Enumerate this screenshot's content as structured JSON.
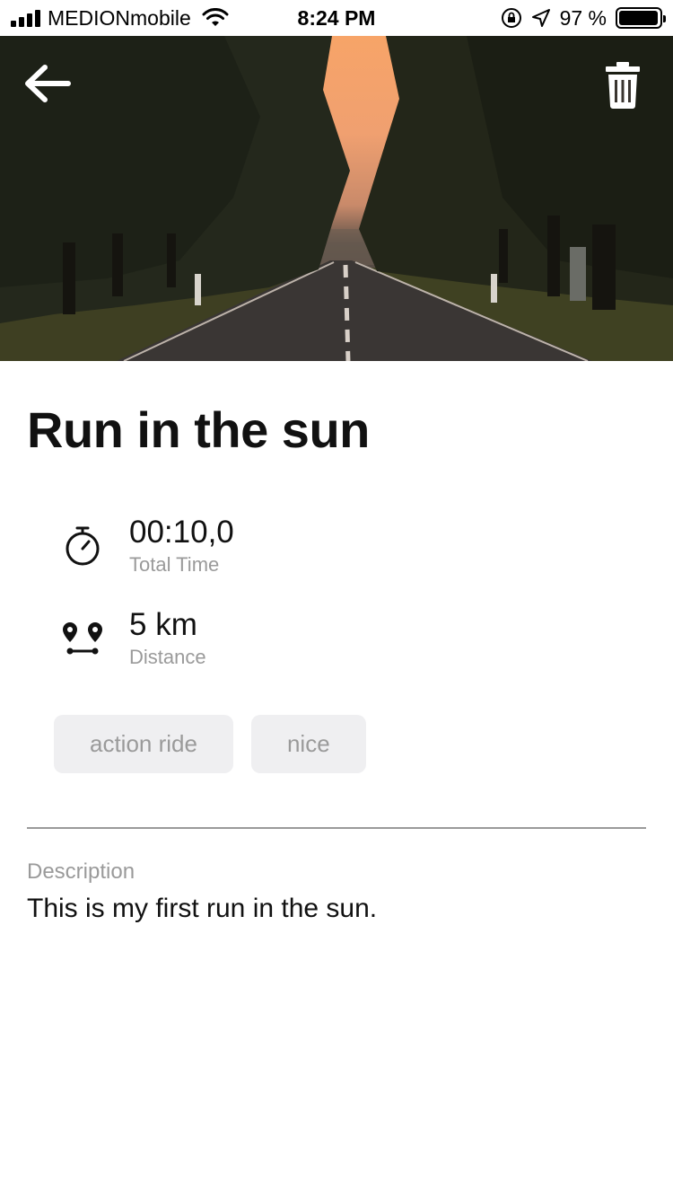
{
  "status_bar": {
    "carrier": "MEDIONmobile",
    "time": "8:24 PM",
    "battery_text": "97 %",
    "battery_level": 0.97,
    "icons": [
      "signal-bars-icon",
      "wifi-icon",
      "orientation-lock-icon",
      "location-arrow-icon",
      "battery-icon"
    ]
  },
  "header": {
    "back_icon": "arrow-left-icon",
    "delete_icon": "trash-icon"
  },
  "activity": {
    "title": "Run in the sun",
    "stats": [
      {
        "icon": "stopwatch-icon",
        "value": "00:10,0",
        "label": "Total Time"
      },
      {
        "icon": "route-pins-icon",
        "value": "5 km",
        "label": "Distance"
      }
    ],
    "tags": [
      "action ride",
      "nice"
    ],
    "description_label": "Description",
    "description": "This is my first run in the sun."
  },
  "colors": {
    "secondary_text": "#9a9a9a",
    "tag_background": "#efeff1",
    "primary_text": "#111111"
  }
}
